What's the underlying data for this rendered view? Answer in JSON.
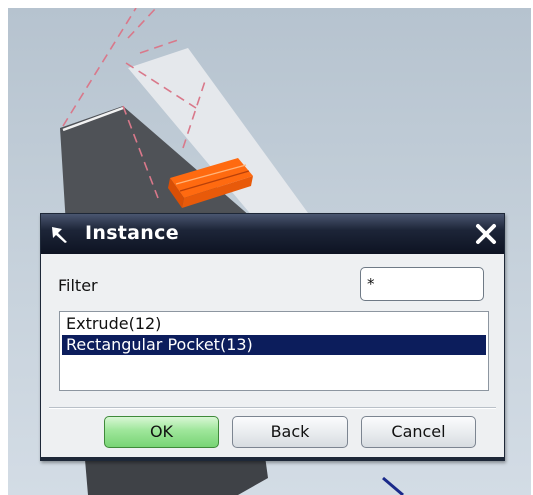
{
  "dialog": {
    "title": "Instance",
    "filter_label": "Filter",
    "filter_value": "*",
    "list_items": [
      {
        "label": "Extrude(12)",
        "selected": false
      },
      {
        "label": "Rectangular Pocket(13)",
        "selected": true
      }
    ],
    "buttons": {
      "ok": "OK",
      "back": "Back",
      "cancel": "Cancel"
    },
    "icons": {
      "pin": "pin-icon",
      "close": "close-icon"
    }
  },
  "colors": {
    "title_bar": "#1d2538",
    "selection": "#0c1d5c",
    "ok_button": "#9ee69a",
    "highlighted_feature": "#ff6a10"
  }
}
